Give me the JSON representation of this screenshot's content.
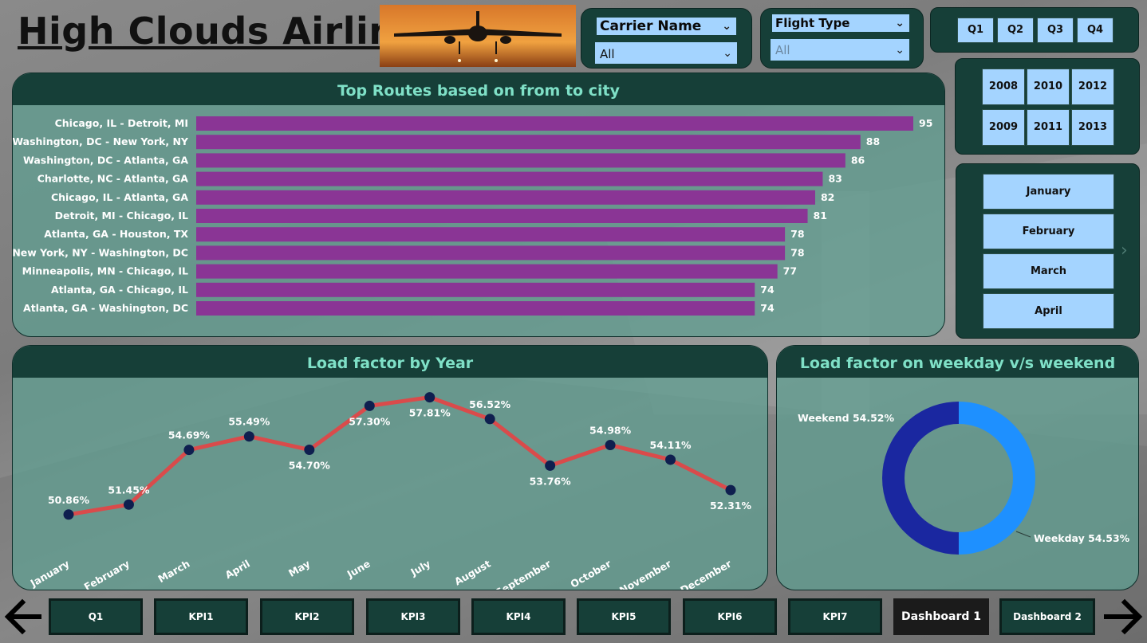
{
  "header": {
    "title": "High Clouds Airlines"
  },
  "hero_image": {
    "icon": "airplane-landing-image"
  },
  "carrier_slicer": {
    "title": "Carrier Name",
    "value": "All"
  },
  "flight_type_slicer": {
    "title": "Flight Type",
    "value": "All"
  },
  "quarters": [
    "Q1",
    "Q2",
    "Q3",
    "Q4"
  ],
  "years": [
    "2008",
    "2010",
    "2012",
    "2009",
    "2011",
    "2013"
  ],
  "months": [
    "January",
    "February",
    "March",
    "April"
  ],
  "routes_chart": {
    "title": "Top Routes based on from to city",
    "chart_data": {
      "type": "bar",
      "orientation": "horizontal",
      "categories": [
        "Chicago, IL - Detroit, MI",
        "Washington, DC - New York, NY",
        "Washington, DC - Atlanta, GA",
        "Charlotte, NC - Atlanta, GA",
        "Chicago, IL - Atlanta, GA",
        "Detroit, MI - Chicago, IL",
        "Atlanta, GA - Houston, TX",
        "New York, NY - Washington, DC",
        "Minneapolis, MN - Chicago, IL",
        "Atlanta, GA - Chicago, IL",
        "Atlanta, GA - Washington, DC"
      ],
      "values": [
        95,
        88,
        86,
        83,
        82,
        81,
        78,
        78,
        77,
        74,
        74
      ],
      "color": "#8a3595"
    }
  },
  "load_chart": {
    "title": "Load factor by Year",
    "chart_data": {
      "type": "line",
      "categories": [
        "January",
        "February",
        "March",
        "April",
        "May",
        "June",
        "July",
        "August",
        "September",
        "October",
        "November",
        "December"
      ],
      "values": [
        50.86,
        51.45,
        54.69,
        55.49,
        54.7,
        57.3,
        57.81,
        56.52,
        53.76,
        54.98,
        54.11,
        52.31
      ],
      "labels": [
        "50.86%",
        "51.45%",
        "54.69%",
        "55.49%",
        "54.70%",
        "57.30%",
        "57.81%",
        "56.52%",
        "53.76%",
        "54.98%",
        "54.11%",
        "52.31%"
      ],
      "line_color": "#d94b4b",
      "marker_color": "#0f1f4f"
    }
  },
  "weekday_chart": {
    "title": "Load factor on weekday v/s weekend",
    "chart_data": {
      "type": "pie",
      "style": "donut",
      "slices": [
        {
          "name": "Weekday",
          "value": 54.53,
          "label": "Weekday 54.53%",
          "color": "#1e90ff"
        },
        {
          "name": "Weekend",
          "value": 54.52,
          "label": "Weekend 54.52%",
          "color": "#1a27a0"
        }
      ]
    }
  },
  "nav": {
    "buttons": [
      "Q1",
      "KPI1",
      "KPI2",
      "KPI3",
      "KPI4",
      "KPI5",
      "KPI6",
      "KPI7"
    ],
    "active": "Dashboard 1",
    "next": "Dashboard 2",
    "prev_icon": "arrow-left-icon",
    "next_icon": "arrow-right-icon"
  }
}
